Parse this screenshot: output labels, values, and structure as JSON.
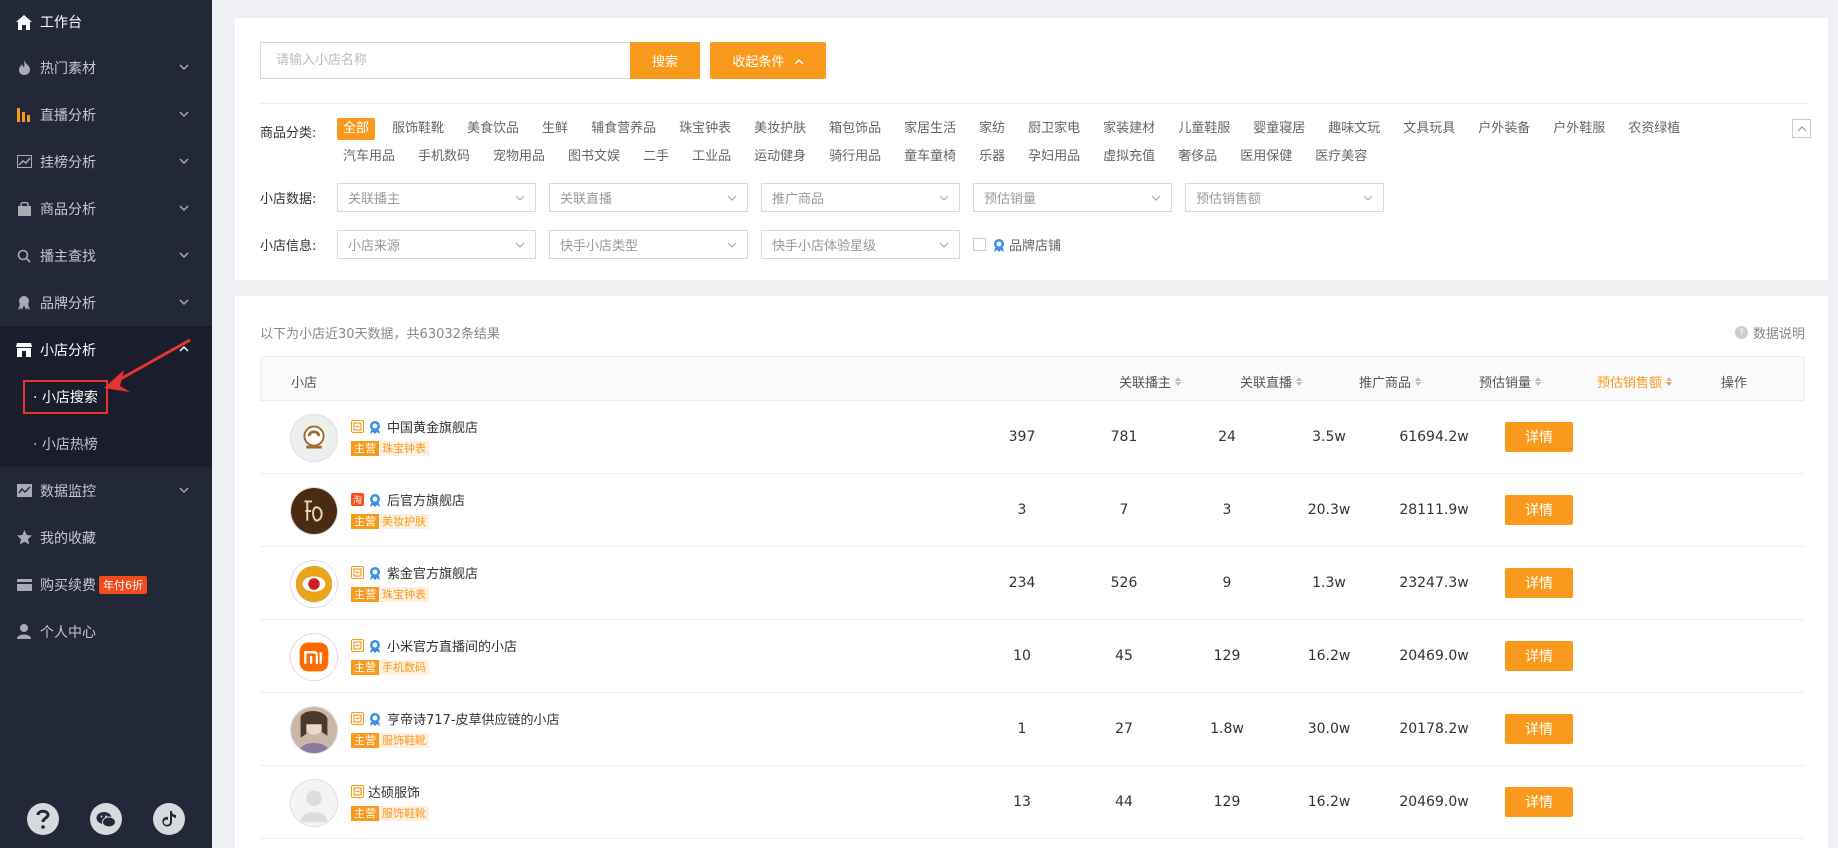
{
  "sidebar": {
    "workbench": "工作台",
    "items": [
      {
        "label": "热门素材"
      },
      {
        "label": "直播分析"
      },
      {
        "label": "挂榜分析"
      },
      {
        "label": "商品分析"
      },
      {
        "label": "播主查找"
      },
      {
        "label": "品牌分析"
      }
    ],
    "shop_group": "小店分析",
    "shop_sub": [
      "· 小店搜索",
      "· 小店热榜"
    ],
    "bottom_items": [
      {
        "label": "数据监控"
      },
      {
        "label": "我的收藏"
      },
      {
        "label": "购买续费",
        "badge": "年付6折"
      },
      {
        "label": "个人中心"
      }
    ]
  },
  "search": {
    "placeholder": "请输入小店名称",
    "button": "搜索",
    "collapse": "收起条件"
  },
  "category": {
    "label": "商品分类:",
    "items": [
      "全部",
      "服饰鞋靴",
      "美食饮品",
      "生鲜",
      "辅食营养品",
      "珠宝钟表",
      "美妆护肤",
      "箱包饰品",
      "家居生活",
      "家纺",
      "厨卫家电",
      "家装建材",
      "儿童鞋服",
      "婴童寝居",
      "趣味文玩",
      "文具玩具",
      "户外装备",
      "户外鞋服",
      "农资绿植",
      "汽车用品",
      "手机数码",
      "宠物用品",
      "图书文娱",
      "二手",
      "工业品",
      "运动健身",
      "骑行用品",
      "童车童椅",
      "乐器",
      "孕妇用品",
      "虚拟充值",
      "奢侈品",
      "医用保健",
      "医疗美容"
    ],
    "active": "全部"
  },
  "shop_data_filter": {
    "label": "小店数据:",
    "selects": [
      "关联播主",
      "关联直播",
      "推广商品",
      "预估销量",
      "预估销售额"
    ]
  },
  "shop_info_filter": {
    "label": "小店信息:",
    "selects": [
      "小店来源",
      "快手小店类型",
      "快手小店体验星级"
    ],
    "brand_checkbox": "品牌店铺"
  },
  "results": {
    "summary": "以下为小店近30天数据，共63032条结果",
    "data_note": "数据说明",
    "columns": {
      "shop": "小店",
      "anchors": "关联播主",
      "lives": "关联直播",
      "products": "推广商品",
      "sales": "预估销量",
      "gmv": "预估销售额",
      "action": "操作"
    },
    "main_tag": "主营",
    "detail": "详情",
    "rows": [
      {
        "name": "中国黄金旗舰店",
        "category": "珠宝钟表",
        "anchors": "397",
        "lives": "781",
        "products": "24",
        "sales": "3.5w",
        "gmv": "61694.2w",
        "platform": "o",
        "brand": true
      },
      {
        "name": "后官方旗舰店",
        "category": "美妆护肤",
        "anchors": "3",
        "lives": "7",
        "products": "3",
        "sales": "20.3w",
        "gmv": "28111.9w",
        "platform": "r",
        "platform_text": "淘",
        "brand": true
      },
      {
        "name": "紫金官方旗舰店",
        "category": "珠宝钟表",
        "anchors": "234",
        "lives": "526",
        "products": "9",
        "sales": "1.3w",
        "gmv": "23247.3w",
        "platform": "o",
        "brand": true
      },
      {
        "name": "小米官方直播间的小店",
        "category": "手机数码",
        "anchors": "10",
        "lives": "45",
        "products": "129",
        "sales": "16.2w",
        "gmv": "20469.0w",
        "platform": "o",
        "brand": true
      },
      {
        "name": "亨帝诗717-皮草供应链的小店",
        "category": "服饰鞋靴",
        "anchors": "1",
        "lives": "27",
        "products": "1.8w",
        "sales": "30.0w",
        "gmv": "20178.2w",
        "platform": "o",
        "brand": true
      },
      {
        "name": "达硕服饰",
        "category": "服饰鞋靴",
        "anchors": "13",
        "lives": "44",
        "products": "129",
        "sales": "16.2w",
        "gmv": "20469.0w",
        "platform": "o",
        "brand": false
      }
    ]
  },
  "colors": {
    "accent": "#f99a1c",
    "sidebar_bg": "#232838",
    "highlight_red": "#e8332f"
  }
}
